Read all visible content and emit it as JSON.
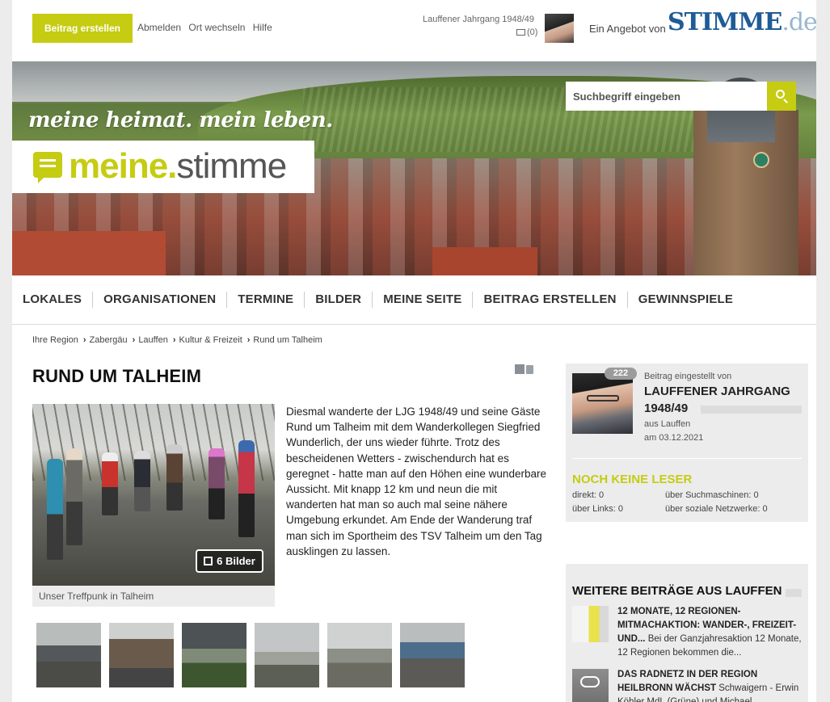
{
  "topbar": {
    "create_label": "Beitrag erstellen",
    "links": [
      "Abmelden",
      "Ort wechseln",
      "Hilfe"
    ],
    "user_name": "Lauffener Jahrgang 1948/49",
    "mail_count": "(0)",
    "angebot": "Ein Angebot von",
    "stimme_main": "STIMME",
    "stimme_tld": ".de"
  },
  "hero": {
    "slogan": "meine heimat. mein leben.",
    "brand_part1": "meine",
    "brand_dot": ".",
    "brand_part2": "stimme",
    "search_placeholder": "Suchbegriff eingeben"
  },
  "nav": [
    "LOKALES",
    "ORGANISATIONEN",
    "TERMINE",
    "BILDER",
    "MEINE SEITE",
    "BEITRAG ERSTELLEN",
    "GEWINNSPIELE"
  ],
  "breadcrumb": [
    "Ihre Region",
    "Zabergäu",
    "Lauffen",
    "Kultur & Freizeit",
    "Rund um Talheim"
  ],
  "article": {
    "title": "RUND UM TALHEIM",
    "bilder_label": "6 Bilder",
    "caption": "Unser Treffpunk in Talheim",
    "text": "Diesmal wanderte der LJG 1948/49 und seine Gäste Rund um Talheim mit dem Wanderkollegen Siegfried Wunderlich, der uns wieder führte. Trotz des bescheidenen Wetters - zwischendurch hat es geregnet - hatte man auf den Höhen eine wunderbare Aussicht. Mit knapp 12 km und neun die mit wanderten hat man so auch mal seine nähere Umgebung erkundet. Am Ende der Wanderung traf man sich im Sportheim des TSV Talheim um den Tag ausklingen zu lassen."
  },
  "author": {
    "badge": "222",
    "eingestellt": "Beitrag eingestellt von",
    "name_line1": "LAUFFENER JAHRGANG",
    "name_line2": "1948/49",
    "aus": "aus Lauffen",
    "am": "am 03.12.2021"
  },
  "readers": {
    "title": "NOCH KEINE LESER",
    "direkt": "direkt: 0",
    "suchmaschinen": "über Suchmaschinen: 0",
    "links": "über Links: 0",
    "soziale": "über soziale Netzwerke: 0"
  },
  "more": {
    "title": "WEITERE BEITRÄGE AUS LAUFFEN",
    "items": [
      {
        "headline": "12 MONATE, 12 REGIONEN-MITMACHAKTION: WANDER-, FREIZEIT- UND...",
        "teaser": " Bei der Ganzjahresaktion 12 Monate, 12 Regionen bekommen die..."
      },
      {
        "headline": "DAS RADNETZ IN DER REGION HEILBRONN WÄCHST",
        "teaser": " Schwaigern - Erwin Köhler MdL (Grüne) und Michael..."
      }
    ]
  },
  "colors": {
    "accent": "#c5cc12",
    "stimme_blue": "#1f5c97"
  }
}
